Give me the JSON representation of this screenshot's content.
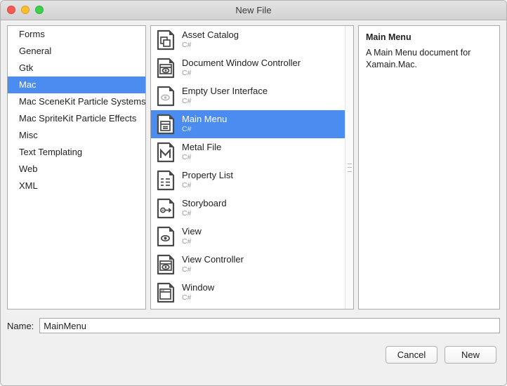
{
  "window": {
    "title": "New File",
    "traffic_lights": [
      {
        "name": "close",
        "color": "#f45b57"
      },
      {
        "name": "minimize",
        "color": "#f9bd2e"
      },
      {
        "name": "zoom",
        "color": "#3fcf49"
      }
    ]
  },
  "categories": {
    "items": [
      {
        "label": "Forms",
        "selected": false
      },
      {
        "label": "General",
        "selected": false
      },
      {
        "label": "Gtk",
        "selected": false
      },
      {
        "label": "Mac",
        "selected": true
      },
      {
        "label": "Mac SceneKit Particle Systems",
        "selected": false
      },
      {
        "label": "Mac SpriteKit Particle Effects",
        "selected": false
      },
      {
        "label": "Misc",
        "selected": false
      },
      {
        "label": "Text Templating",
        "selected": false
      },
      {
        "label": "Web",
        "selected": false
      },
      {
        "label": "XML",
        "selected": false
      }
    ]
  },
  "templates": {
    "items": [
      {
        "name": "Asset Catalog",
        "language": "C#",
        "icon": "asset-catalog-icon",
        "selected": false
      },
      {
        "name": "Document Window Controller",
        "language": "C#",
        "icon": "document-window-controller-icon",
        "selected": false
      },
      {
        "name": "Empty User Interface",
        "language": "C#",
        "icon": "empty-user-interface-icon",
        "selected": false
      },
      {
        "name": "Main Menu",
        "language": "C#",
        "icon": "main-menu-icon",
        "selected": true
      },
      {
        "name": "Metal File",
        "language": "C#",
        "icon": "metal-file-icon",
        "selected": false
      },
      {
        "name": "Property List",
        "language": "C#",
        "icon": "property-list-icon",
        "selected": false
      },
      {
        "name": "Storyboard",
        "language": "C#",
        "icon": "storyboard-icon",
        "selected": false
      },
      {
        "name": "View",
        "language": "C#",
        "icon": "view-icon",
        "selected": false
      },
      {
        "name": "View Controller",
        "language": "C#",
        "icon": "view-controller-icon",
        "selected": false
      },
      {
        "name": "Window",
        "language": "C#",
        "icon": "window-icon",
        "selected": false
      }
    ]
  },
  "description": {
    "title": "Main Menu",
    "text": "A Main Menu document for Xamain.Mac."
  },
  "name_field": {
    "label": "Name:",
    "value": "MainMenu",
    "placeholder": ""
  },
  "footer": {
    "cancel_label": "Cancel",
    "new_label": "New"
  },
  "colors": {
    "selection_blue": "#4a8cf0",
    "window_background": "#f0f0f0",
    "pane_background": "#ffffff"
  }
}
